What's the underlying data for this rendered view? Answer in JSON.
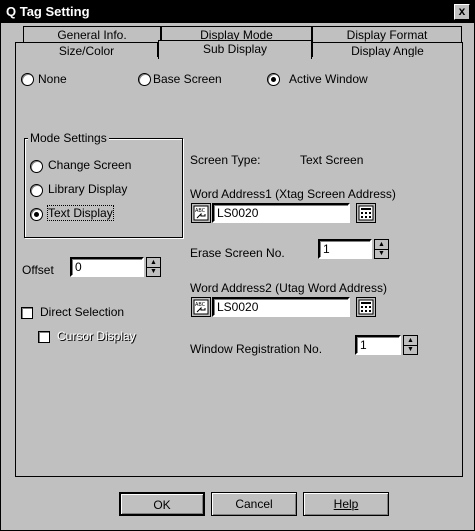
{
  "window": {
    "title": "Q Tag Setting",
    "close_label": "x"
  },
  "tabs_row1": [
    "General Info.",
    "Display Mode",
    "Display Format"
  ],
  "tabs_row2": [
    "Size/Color",
    "Sub Display",
    "Display Angle"
  ],
  "active_tab": "Sub Display",
  "sub_display_radios": [
    {
      "label": "None",
      "selected": false
    },
    {
      "label": "Base Screen",
      "selected": false
    },
    {
      "label": "Active Window",
      "selected": true
    }
  ],
  "mode_settings": {
    "legend": "Mode Settings",
    "options": [
      {
        "label": "Change Screen",
        "selected": false
      },
      {
        "label": "Library Display",
        "selected": false
      },
      {
        "label": "Text Display",
        "selected": true
      }
    ]
  },
  "offset": {
    "label": "Offset",
    "value": "0"
  },
  "direct_selection": {
    "label": "Direct Selection",
    "checked": false
  },
  "cursor_display": {
    "label": "Cursor Display",
    "checked": false
  },
  "screen_type": {
    "label": "Screen Type:",
    "value": "Text Screen"
  },
  "word_address1": {
    "label": "Word Address1   (Xtag Screen Address)",
    "value": "LS0020"
  },
  "erase_screen": {
    "label": "Erase Screen No.",
    "value": "1"
  },
  "word_address2": {
    "label": "Word Address2 (Utag Word Address)",
    "value": "LS0020"
  },
  "window_registration": {
    "label": "Window Registration No.",
    "value": "1"
  },
  "buttons": {
    "ok": "OK",
    "cancel": "Cancel",
    "help": "Help"
  }
}
